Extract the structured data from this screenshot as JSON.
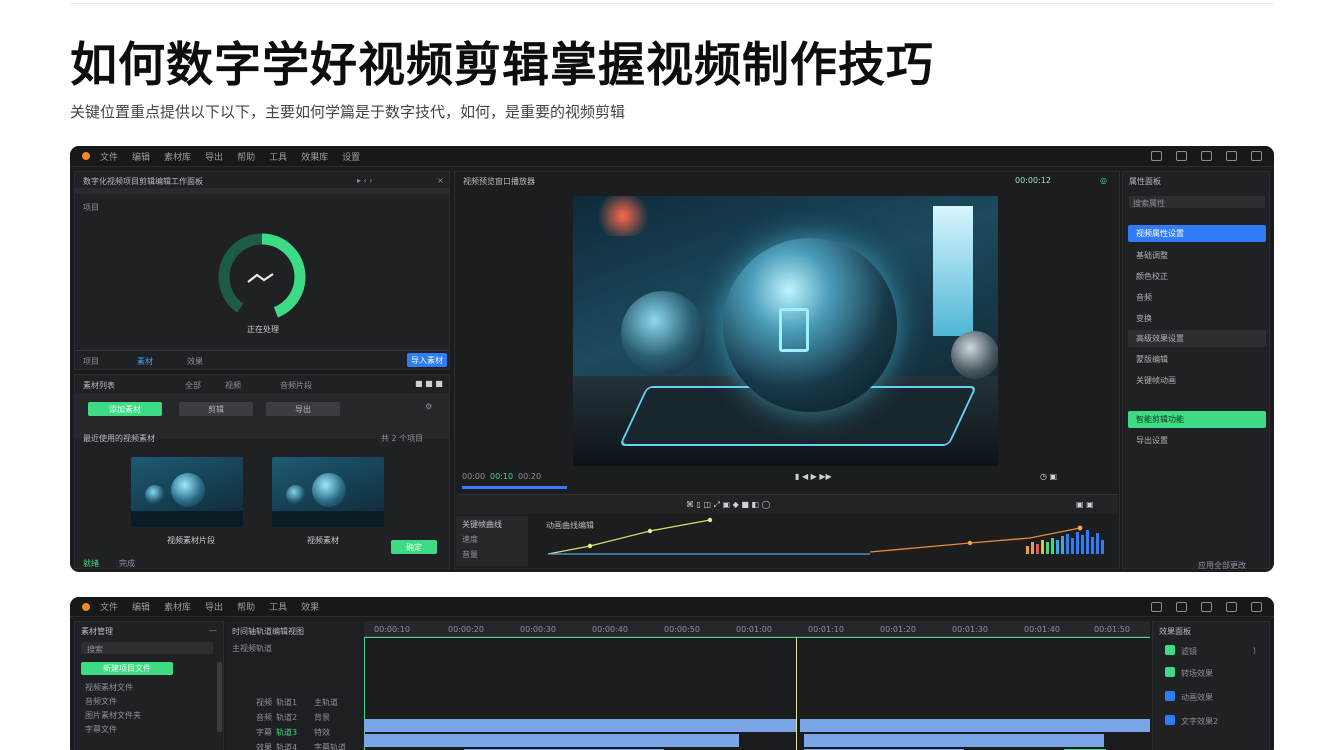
{
  "article": {
    "headline": "如何数字学好视频剪辑掌握视频制作技巧",
    "subline": "关键位置重点提供以下以下，主要如何学篇是于数字技代，如何，是重要的视频剪辑"
  },
  "colors": {
    "accent_green": "#3ddc84",
    "accent_blue": "#2f7cf6",
    "window_bg": "#1b1c1e",
    "orange": "#f08a24"
  },
  "win1": {
    "menu": [
      "文件",
      "编辑",
      "素材库",
      "导出",
      "帮助",
      "工具",
      "效果库",
      "设置"
    ],
    "left_panel": {
      "header": "数字化视频项目剪辑编辑工作面板",
      "section": "项目",
      "gauge_label": "正在处理",
      "tabs": [
        "项目",
        "素材",
        "效果"
      ],
      "action_button": "导入素材",
      "sub_header": "素材列表",
      "sub_tabs": [
        "全部",
        "视频",
        "音频片段"
      ],
      "buttons": [
        "添加素材",
        "剪辑",
        "导出"
      ],
      "media_header": "最近使用的视频素材",
      "media_meta": "共 2 个项目",
      "thumbs": [
        "视频素材片段",
        "视频素材"
      ],
      "confirm": "确定",
      "footer": [
        "就绪",
        "完成"
      ]
    },
    "center": {
      "header": "视频预览窗口播放器",
      "time": "00:00:12",
      "timecodes": [
        "00:00",
        "00:10",
        "00:20"
      ],
      "graph_labels": [
        "关键帧曲线",
        "速度",
        "音量"
      ],
      "graph_title": "动画曲线编辑"
    },
    "right_panel": {
      "header": "属性面板",
      "search": "搜索属性",
      "items": [
        "视频属性设置",
        "基础调整",
        "颜色校正",
        "音频",
        "变换",
        "高级效果设置",
        "蒙版编辑",
        "关键帧动画",
        "智能剪辑功能",
        "导出设置"
      ],
      "selected_blue": "视频属性设置",
      "selected_green": "智能剪辑功能",
      "footer": "应用全部更改"
    }
  },
  "win2": {
    "menu": [
      "文件",
      "编辑",
      "素材库",
      "导出",
      "帮助",
      "工具",
      "效果"
    ],
    "left_header": "素材管理",
    "search": "搜索",
    "green_item": "新建项目文件",
    "list": [
      "视频素材文件",
      "音频文件",
      "图片素材文件夹",
      "字幕文件"
    ],
    "track_header": "时间轴轨道编辑视图",
    "track_sub": "主视频轨道",
    "ruler": [
      "00:00:10",
      "00:00:20",
      "00:00:30",
      "00:00:40",
      "00:00:50",
      "00:01:00",
      "00:01:10",
      "00:01:20",
      "00:01:30",
      "00:01:40",
      "00:01:50"
    ],
    "track_labels": [
      [
        "视频",
        "轨道1",
        "主轨道"
      ],
      [
        "音频",
        "轨道2",
        "背景"
      ],
      [
        "字幕",
        "轨道3",
        "特效"
      ],
      [
        "效果",
        "轨道4",
        "字幕轨道"
      ]
    ],
    "right_header": "效果面板",
    "right_items": [
      "滤镜",
      "转场效果",
      "动画效果",
      "文字效果2"
    ]
  }
}
